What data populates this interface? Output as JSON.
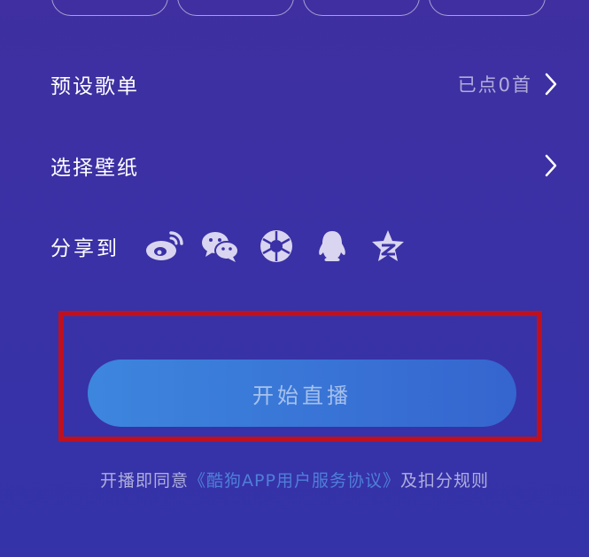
{
  "preset_playlist": {
    "label": "预设歌单",
    "value": "已点0首"
  },
  "wallpaper": {
    "label": "选择壁纸"
  },
  "share": {
    "label": "分享到",
    "icons": [
      "weibo-icon",
      "wechat-icon",
      "moments-icon",
      "qq-icon",
      "qzone-icon"
    ]
  },
  "start_button": {
    "label": "开始直播"
  },
  "agreement": {
    "prefix": "开播即同意",
    "link": "《酷狗APP用户服务协议》",
    "suffix": "及扣分规则"
  },
  "colors": {
    "background": "#3a31a6",
    "button": "#3d86de",
    "highlight_box": "#c0101e",
    "link": "#4f7fd8"
  }
}
